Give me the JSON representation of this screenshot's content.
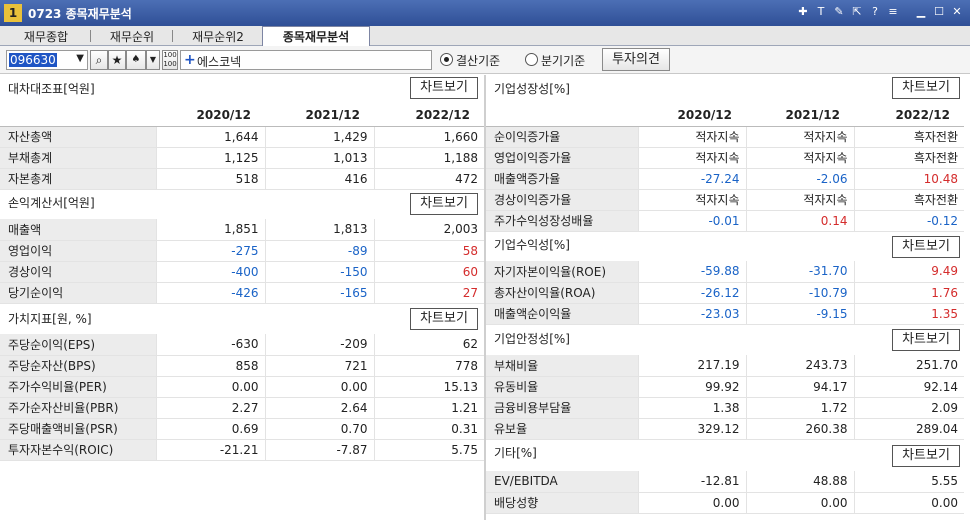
{
  "window": {
    "number": "1",
    "title": "0723 종목재무분석"
  },
  "title_icons": [
    "plus-icon",
    "text-icon",
    "edit-icon",
    "link-icon",
    "help-icon",
    "menu-icon",
    "minimize-icon",
    "maximize-icon",
    "close-icon"
  ],
  "tabs": [
    {
      "label": "재무종합",
      "active": false
    },
    {
      "label": "재무순위",
      "active": false
    },
    {
      "label": "재무순위2",
      "active": false
    },
    {
      "label": "종목재무분석",
      "active": true
    }
  ],
  "toolbar": {
    "code": "096630",
    "company": "에스코넥",
    "radio_settlement": "결산기준",
    "radio_quarter": "분기기준",
    "opinion_button": "투자의견"
  },
  "chart_button_label": "차트보기",
  "years": [
    "2020/12",
    "2021/12",
    "2022/12"
  ],
  "left": {
    "balance": {
      "title": "대차대조표[억원]",
      "rows": [
        {
          "label": "자산총액",
          "v": [
            "1,644",
            "1,429",
            "1,660"
          ]
        },
        {
          "label": "부채총계",
          "v": [
            "1,125",
            "1,013",
            "1,188"
          ]
        },
        {
          "label": "자본총계",
          "v": [
            "518",
            "416",
            "472"
          ]
        }
      ]
    },
    "income": {
      "title": "손익계산서[억원]",
      "rows": [
        {
          "label": "매출액",
          "v": [
            "1,851",
            "1,813",
            "2,003"
          ]
        },
        {
          "label": "영업이익",
          "v": [
            "-275",
            "-89",
            "58"
          ]
        },
        {
          "label": "경상이익",
          "v": [
            "-400",
            "-150",
            "60"
          ]
        },
        {
          "label": "당기순이익",
          "v": [
            "-426",
            "-165",
            "27"
          ]
        }
      ]
    },
    "value": {
      "title": "가치지표[원, %]",
      "rows": [
        {
          "label": "주당순이익(EPS)",
          "v": [
            "-630",
            "-209",
            "62"
          ]
        },
        {
          "label": "주당순자산(BPS)",
          "v": [
            "858",
            "721",
            "778"
          ]
        },
        {
          "label": "주가수익비율(PER)",
          "v": [
            "0.00",
            "0.00",
            "15.13"
          ]
        },
        {
          "label": "주가순자산비율(PBR)",
          "v": [
            "2.27",
            "2.64",
            "1.21"
          ]
        },
        {
          "label": "주당매출액비율(PSR)",
          "v": [
            "0.69",
            "0.70",
            "0.31"
          ]
        },
        {
          "label": "투자자본수익(ROIC)",
          "v": [
            "-21.21",
            "-7.87",
            "5.75"
          ]
        }
      ]
    }
  },
  "right": {
    "growth": {
      "title": "기업성장성[%]",
      "rows": [
        {
          "label": "순이익증가율",
          "v": [
            "적자지속",
            "적자지속",
            "흑자전환"
          ]
        },
        {
          "label": "영업이익증가율",
          "v": [
            "적자지속",
            "적자지속",
            "흑자전환"
          ]
        },
        {
          "label": "매출액증가율",
          "v": [
            "-27.24",
            "-2.06",
            "10.48"
          ]
        },
        {
          "label": "경상이익증가율",
          "v": [
            "적자지속",
            "적자지속",
            "흑자전환"
          ]
        },
        {
          "label": "주가수익성장성배율",
          "v": [
            "-0.01",
            "0.14",
            "-0.12"
          ]
        }
      ]
    },
    "profit": {
      "title": "기업수익성[%]",
      "rows": [
        {
          "label": "자기자본이익율(ROE)",
          "v": [
            "-59.88",
            "-31.70",
            "9.49"
          ]
        },
        {
          "label": "총자산이익율(ROA)",
          "v": [
            "-26.12",
            "-10.79",
            "1.76"
          ]
        },
        {
          "label": "매출액순이익율",
          "v": [
            "-23.03",
            "-9.15",
            "1.35"
          ]
        }
      ]
    },
    "stability": {
      "title": "기업안정성[%]",
      "rows": [
        {
          "label": "부채비율",
          "v": [
            "217.19",
            "243.73",
            "251.70"
          ]
        },
        {
          "label": "유동비율",
          "v": [
            "99.92",
            "94.17",
            "92.14"
          ]
        },
        {
          "label": "금융비용부담율",
          "v": [
            "1.38",
            "1.72",
            "2.09"
          ]
        },
        {
          "label": "유보율",
          "v": [
            "329.12",
            "260.38",
            "289.04"
          ]
        }
      ]
    },
    "etc": {
      "title": "기타[%]",
      "rows": [
        {
          "label": "EV/EBITDA",
          "v": [
            "-12.81",
            "48.88",
            "5.55"
          ]
        },
        {
          "label": "배당성향",
          "v": [
            "0.00",
            "0.00",
            "0.00"
          ]
        }
      ]
    }
  },
  "colors": {
    "positive": "#d42c2c",
    "negative": "#1a63c7",
    "title_bar": "#3a5ca6"
  }
}
